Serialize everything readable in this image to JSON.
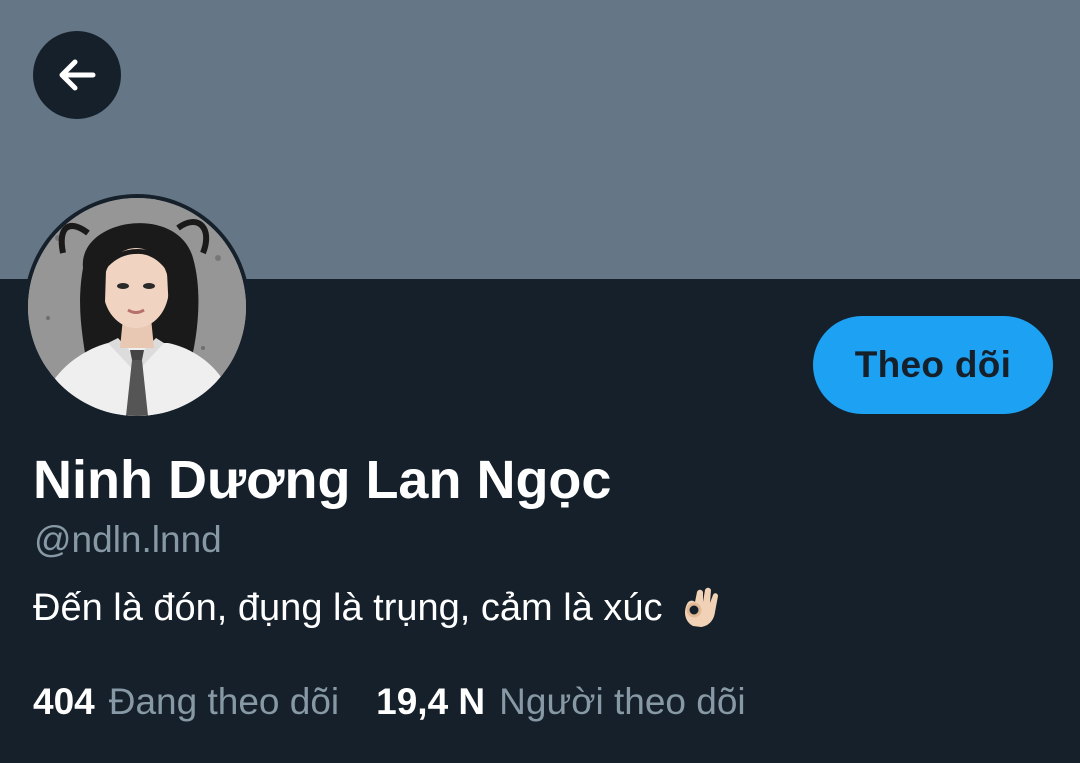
{
  "profile": {
    "display_name": "Ninh Dương Lan Ngọc",
    "handle": "@ndln.lnnd",
    "bio_text": "Đến là đón, đụng là trụng, cảm là xúc",
    "bio_emoji": "ok-hand-emoji",
    "follow_label": "Theo dõi"
  },
  "stats": {
    "following_count": "404",
    "following_label": "Đang theo dõi",
    "followers_count": "19,4 N",
    "followers_label": "Người theo dõi"
  },
  "icons": {
    "back": "arrow-left-icon",
    "avatar": "profile-photo"
  },
  "colors": {
    "background": "#15202b",
    "banner": "#657786",
    "accent": "#1da1f2",
    "secondary_text": "#8899a6",
    "primary_text": "#ffffff"
  }
}
